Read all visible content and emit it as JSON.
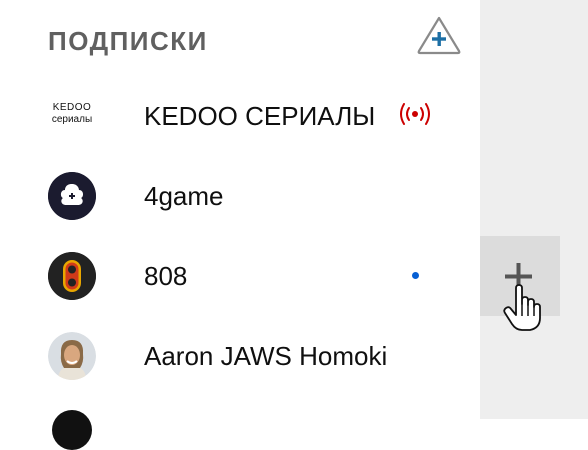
{
  "section": {
    "title": "ПОДПИСКИ",
    "add_button_icon": "add-subscription-icon"
  },
  "subscriptions": [
    {
      "name": "KEDOO СЕРИАЛЫ",
      "logo_line1": "KEDOO",
      "logo_line2": "сериалы",
      "status": "live",
      "status_color": "#cc0000"
    },
    {
      "name": "4game",
      "status": "none",
      "avatar_color": "#1b1b2f"
    },
    {
      "name": "808",
      "status": "new-content",
      "status_color": "#065fd4",
      "avatar_color": "#222222"
    },
    {
      "name": "Aaron JAWS Homoki",
      "status": "none"
    }
  ],
  "side_panel": {
    "expand_button_icon": "plus-icon",
    "cursor_icon": "hand-pointer-icon"
  }
}
